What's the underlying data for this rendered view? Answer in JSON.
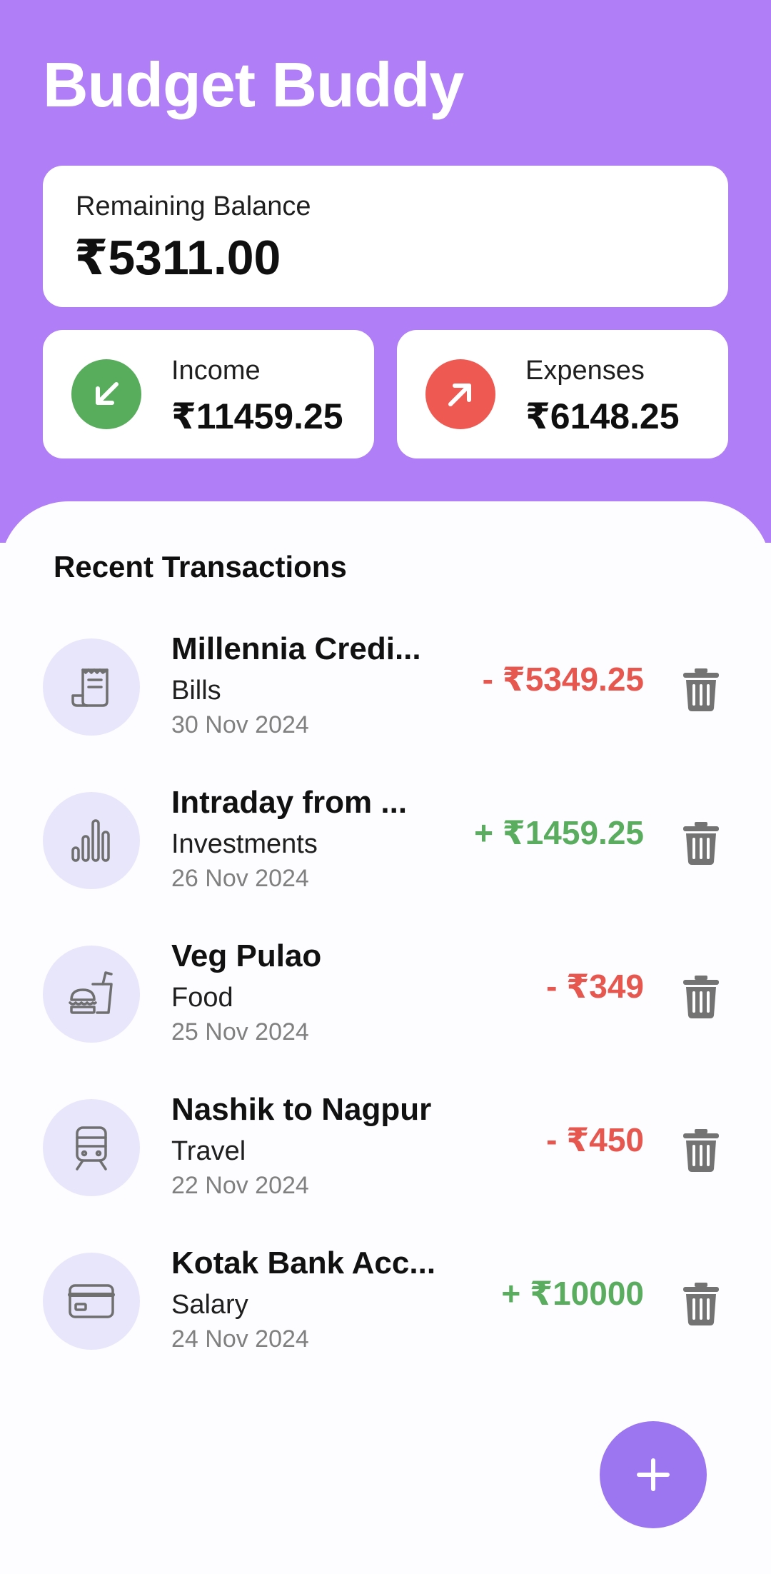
{
  "app": {
    "title": "Budget Buddy",
    "accent_color": "#b07ef6"
  },
  "balance": {
    "label": "Remaining Balance",
    "amount": "₹5311.00"
  },
  "income": {
    "label": "Income",
    "amount": "₹11459.25",
    "icon": "arrow-down-left-icon",
    "color": "#58ad5c"
  },
  "expenses": {
    "label": "Expenses",
    "amount": "₹6148.25",
    "icon": "arrow-up-right-icon",
    "color": "#ee5a52"
  },
  "recent": {
    "title": "Recent Transactions",
    "items": [
      {
        "title": "Millennia Credi...",
        "category": "Bills",
        "date": "30 Nov 2024",
        "amount": "- ₹5349.25",
        "type": "debit",
        "icon": "receipt-icon"
      },
      {
        "title": "Intraday from ...",
        "category": "Investments",
        "date": "26 Nov 2024",
        "amount": "+ ₹1459.25",
        "type": "credit",
        "icon": "bar-chart-icon"
      },
      {
        "title": "Veg Pulao",
        "category": "Food",
        "date": "25 Nov 2024",
        "amount": "- ₹349",
        "type": "debit",
        "icon": "fast-food-icon"
      },
      {
        "title": "Nashik to Nagpur",
        "category": "Travel",
        "date": "22 Nov 2024",
        "amount": "- ₹450",
        "type": "debit",
        "icon": "train-icon"
      },
      {
        "title": "Kotak Bank Acc...",
        "category": "Salary",
        "date": "24 Nov 2024",
        "amount": "+ ₹10000",
        "type": "credit",
        "icon": "credit-card-icon"
      }
    ]
  },
  "fab": {
    "icon": "plus-icon",
    "color": "#9c76f0"
  }
}
